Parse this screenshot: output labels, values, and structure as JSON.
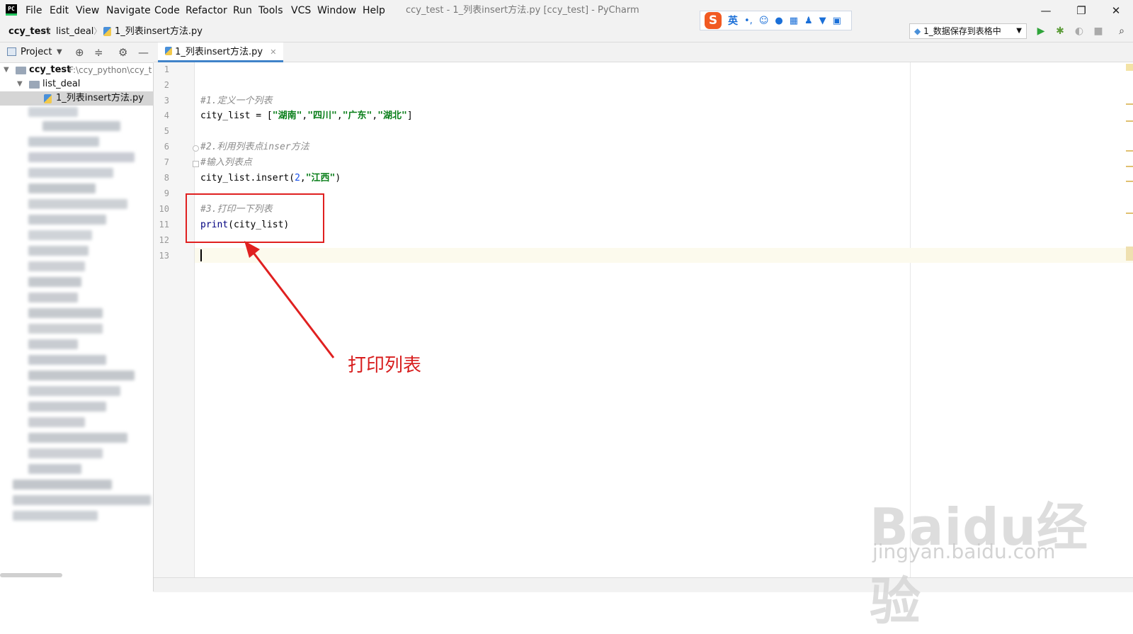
{
  "app": {
    "logo_text": "PC",
    "window_title": "ccy_test - 1_列表insert方法.py [ccy_test] - PyCharm",
    "menu": [
      "File",
      "Edit",
      "View",
      "Navigate",
      "Code",
      "Refactor",
      "Run",
      "Tools",
      "VCS",
      "Window",
      "Help"
    ],
    "window_controls": {
      "minimize": "—",
      "restore": "❐",
      "close": "✕"
    }
  },
  "ime": {
    "logo": "S",
    "mode": "英",
    "icons": [
      "punct-icon",
      "emoji-icon",
      "mic-icon",
      "keyboard-icon",
      "user-icon",
      "skin-icon",
      "apps-icon"
    ]
  },
  "nav": {
    "breadcrumbs": [
      "ccy_test",
      "list_deal",
      "1_列表insert方法.py"
    ],
    "run_config": "1_数据保存到表格中"
  },
  "project": {
    "header_label": "Project",
    "tree": [
      {
        "label": "ccy_test",
        "path": "F:\\ccy_python\\ccy_t",
        "bold": true
      },
      {
        "label": "list_deal"
      },
      {
        "label": "1_列表insert方法.py",
        "selected": true
      }
    ]
  },
  "editor": {
    "tab_label": "1_列表insert方法.py",
    "line_numbers": [
      "1",
      "2",
      "3",
      "4",
      "5",
      "6",
      "7",
      "8",
      "9",
      "10",
      "11",
      "12",
      "13"
    ],
    "lines": {
      "l3": "#1.定义一个列表",
      "l4_a": "city_list = [",
      "l4_s1": "\"湖南\"",
      "l4_s2": "\"四川\"",
      "l4_s3": "\"广东\"",
      "l4_s4": "\"湖北\"",
      "l4_c": ",",
      "l4_end": "]",
      "l6": "#2.利用列表点inser方法",
      "l7": "#输入列表点",
      "l8_a": "city_list.insert(",
      "l8_num": "2",
      "l8_str": "\"江西\"",
      "l8_end": ")",
      "l10": "#3.打印一下列表",
      "l11_kw": "print",
      "l11_rest": "(city_list)"
    }
  },
  "annotation": {
    "label": "打印列表"
  },
  "watermark": {
    "brand": "Baidu经验",
    "url": "jingyan.baidu.com"
  },
  "colors": {
    "annotation_red": "#e02020",
    "string_green": "#067d17",
    "comment_gray": "#8c8c8c",
    "tab_underline": "#4083c9"
  }
}
